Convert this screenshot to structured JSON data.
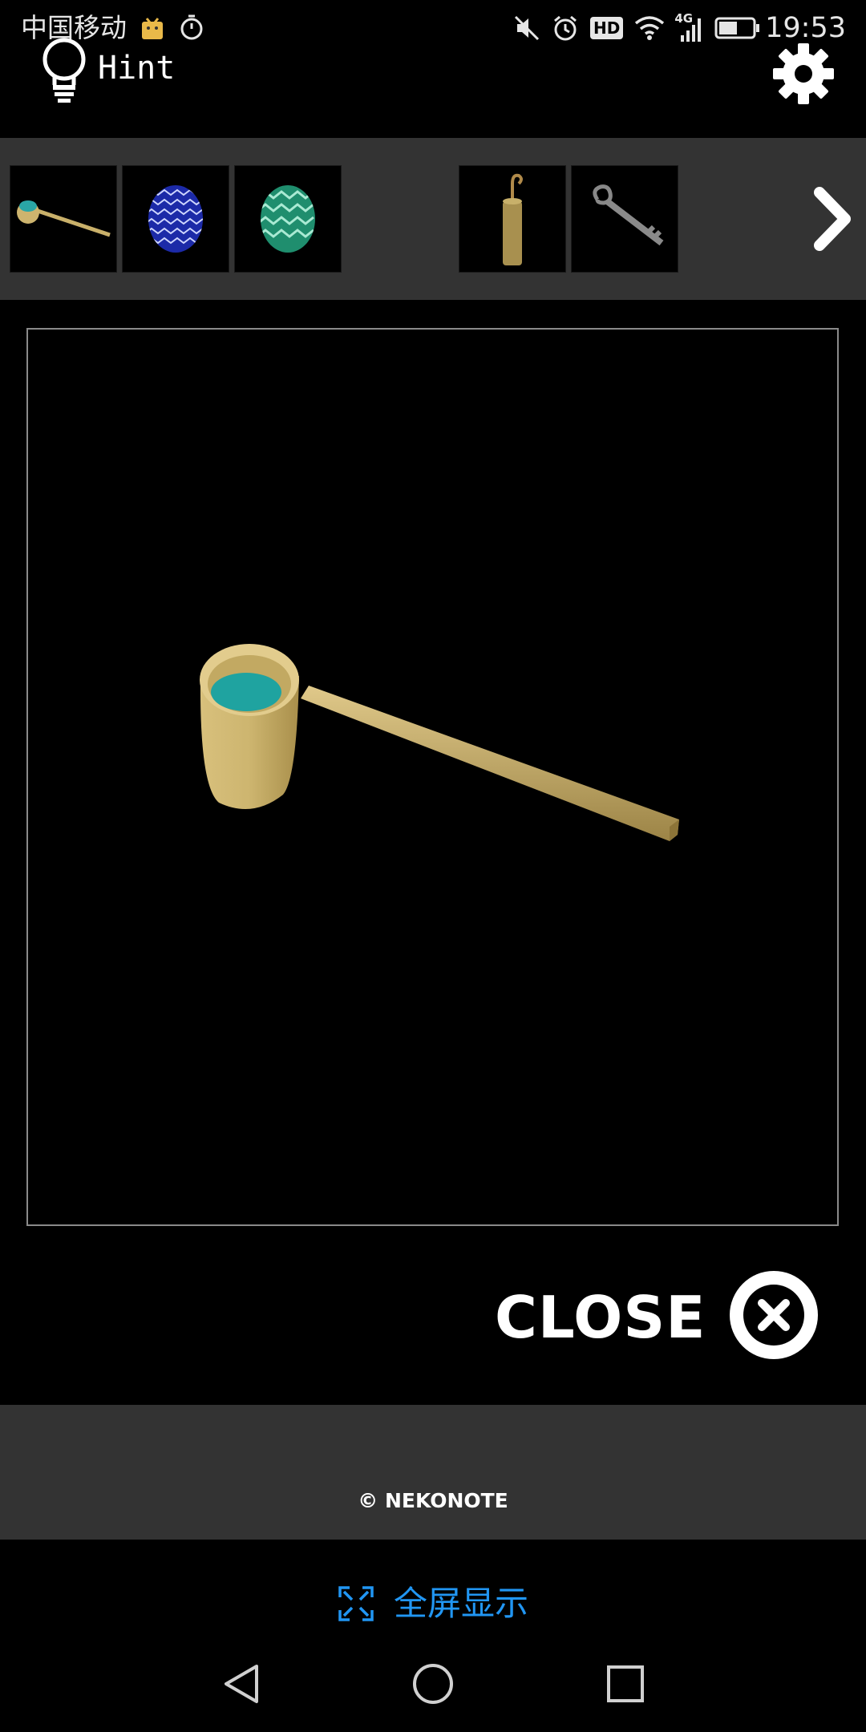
{
  "status_bar": {
    "carrier": "中国移动",
    "time": "19:53",
    "network": "4G",
    "hd_label": "HD"
  },
  "top_bar": {
    "hint_label": "Hint"
  },
  "inventory": {
    "items": [
      {
        "name": "ladle"
      },
      {
        "name": "blue-zigzag-egg"
      },
      {
        "name": "green-zigzag-egg"
      },
      {
        "name": "empty"
      },
      {
        "name": "hook-cylinder"
      },
      {
        "name": "key"
      }
    ]
  },
  "viewer": {
    "item": "ladle"
  },
  "close": {
    "label": "CLOSE"
  },
  "footer": {
    "copyright": "© NEKONOTE"
  },
  "fullscreen": {
    "label": "全屏显示"
  },
  "colors": {
    "accent": "#2196f3",
    "panel": "#333333",
    "background": "#000000"
  }
}
